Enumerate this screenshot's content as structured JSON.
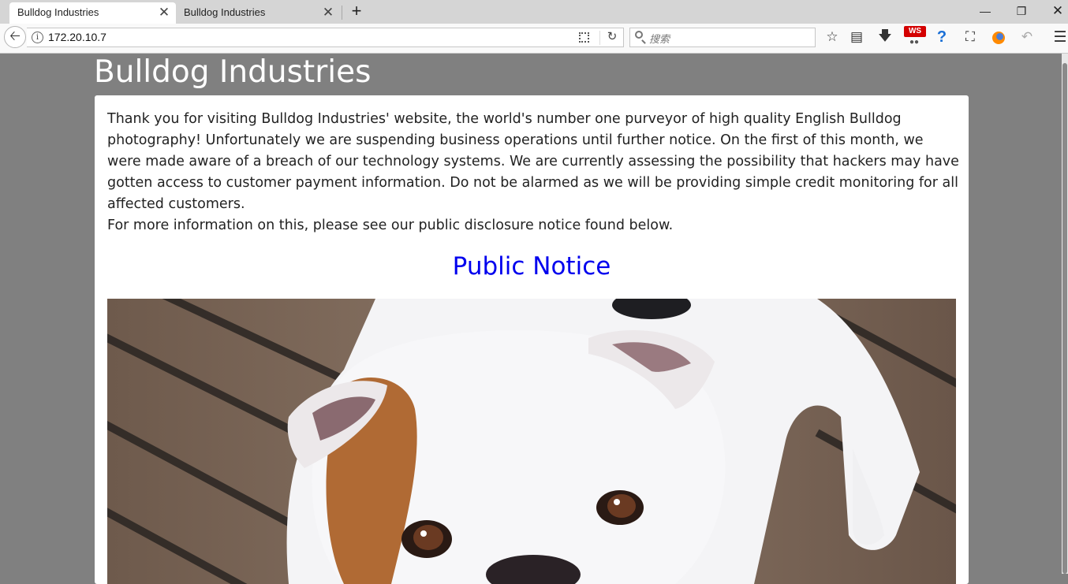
{
  "browser": {
    "tabs": [
      {
        "title": "Bulldog Industries",
        "active": true
      },
      {
        "title": "Bulldog Industries",
        "active": false
      }
    ],
    "url": "172.20.10.7",
    "search_placeholder": "搜索",
    "ws_badge": "WS"
  },
  "page": {
    "title": "Bulldog Industries",
    "paragraphs": [
      "Thank you for visiting Bulldog Industries' website, the world's number one purveyor of high quality English Bulldog photography! Unfortunately we are suspending business operations until further notice. On the first of this month, we were made aware of a breach of our technology systems. We are currently assessing the possibility that hackers may have gotten access to customer payment information. Do not be alarmed as we will be providing simple credit monitoring for all affected customers.",
      "For more information on this, please see our public disclosure notice found below."
    ],
    "notice_link": "Public Notice"
  },
  "colors": {
    "background": "#808080",
    "card": "#ffffff",
    "link": "#0000ee"
  },
  "icons": [
    "close-icon",
    "plus-icon",
    "minimize-icon",
    "restore-icon",
    "back-arrow-icon",
    "info-icon",
    "qr-code-icon",
    "reload-icon",
    "search-icon",
    "star-icon",
    "reading-list-icon",
    "download-icon",
    "help-icon",
    "crop-icon",
    "firefox-icon",
    "undo-icon",
    "hamburger-menu-icon"
  ]
}
